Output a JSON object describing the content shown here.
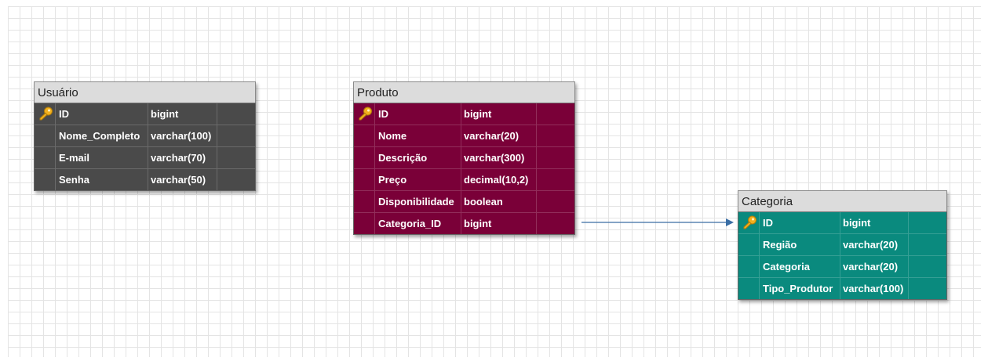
{
  "colors": {
    "usuario_body": "#4a4a4a",
    "produto_body": "#7a0038",
    "categoria_body": "#0a8a7e",
    "header_bg": "#dcdcdc",
    "relation_line": "#3a6ea5",
    "key_icon": "#f2b01e"
  },
  "entities": {
    "usuario": {
      "title": "Usuário",
      "columns": [
        {
          "name": "ID",
          "type": "bigint",
          "primary_key": true
        },
        {
          "name": "Nome_Completo",
          "type": "varchar(100)",
          "primary_key": false
        },
        {
          "name": "E-mail",
          "type": "varchar(70)",
          "primary_key": false
        },
        {
          "name": "Senha",
          "type": "varchar(50)",
          "primary_key": false
        }
      ]
    },
    "produto": {
      "title": "Produto",
      "columns": [
        {
          "name": "ID",
          "type": "bigint",
          "primary_key": true
        },
        {
          "name": "Nome",
          "type": "varchar(20)",
          "primary_key": false
        },
        {
          "name": "Descrição",
          "type": "varchar(300)",
          "primary_key": false
        },
        {
          "name": "Preço",
          "type": "decimal(10,2)",
          "primary_key": false
        },
        {
          "name": "Disponibilidade",
          "type": "boolean",
          "primary_key": false
        },
        {
          "name": "Categoria_ID",
          "type": "bigint",
          "primary_key": false
        }
      ]
    },
    "categoria": {
      "title": "Categoria",
      "columns": [
        {
          "name": "ID",
          "type": "bigint",
          "primary_key": true
        },
        {
          "name": "Região",
          "type": "varchar(20)",
          "primary_key": false
        },
        {
          "name": "Categoria",
          "type": "varchar(20)",
          "primary_key": false
        },
        {
          "name": "Tipo_Produtor",
          "type": "varchar(100)",
          "primary_key": false
        }
      ]
    }
  },
  "relations": [
    {
      "from": "produto.Categoria_ID",
      "to": "categoria.ID",
      "icon": "arrow-right-icon"
    }
  ]
}
